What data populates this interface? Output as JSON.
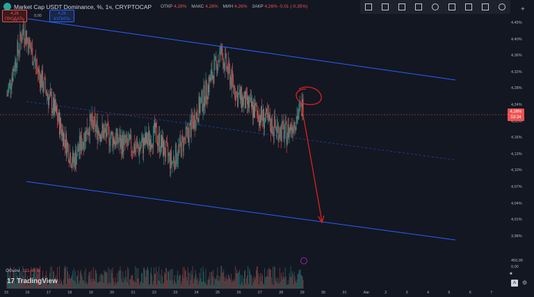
{
  "header": {
    "title": "Market Cap USDT Dominance, %, 1ч, CRYPTOCAP",
    "ohlc": [
      {
        "label": "ОТКР",
        "value": "4,28%"
      },
      {
        "label": "МАКС",
        "value": "4,28%"
      },
      {
        "label": "МИН",
        "value": "4,26%"
      },
      {
        "label": "ЗАКР",
        "value": "4,26%  -0,01 (-0,35%)"
      }
    ]
  },
  "trade": {
    "sell_price": "4,26",
    "sell_label": "ПРОДАТЬ",
    "spread": "0,00",
    "buy_price": "4,26",
    "buy_label": "КУПИТЬ"
  },
  "toolbar": {
    "icons": [
      "rectangle-tool-icon",
      "parallel-channel-icon",
      "fib-icon",
      "pitchfork-icon",
      "pattern-icon",
      "long-position-icon",
      "short-position-icon",
      "arrow-tool-icon",
      "eraser-icon"
    ]
  },
  "price_axis": {
    "labels": [
      "4,45%",
      "4,40%",
      "4,36%",
      "4,32%",
      "4,28%",
      "4,24%",
      "4,20%",
      "4,16%",
      "4,13%",
      "4,10%",
      "4,07%",
      "4,04%",
      "4,01%",
      "3,98%"
    ],
    "current_price": "4,26%",
    "countdown": "53:34",
    "volume_axis": "450,00",
    "volume_axis2": "0,00"
  },
  "time_axis": {
    "labels": [
      "15",
      "16",
      "17",
      "18",
      "19",
      "20",
      "21",
      "22",
      "23",
      "24",
      "25",
      "26",
      "27",
      "28",
      "29",
      "30",
      "31",
      "Авг",
      "2",
      "3",
      "4",
      "5",
      "6",
      "7"
    ]
  },
  "volume": {
    "label": "Объём",
    "value": "111,48 В"
  },
  "brand": {
    "name": "TradingView"
  },
  "colors": {
    "background": "#131722",
    "channel_line": "#2962ff",
    "annotation": "#e0201d",
    "down": "#ef5350",
    "up": "#26a69a"
  },
  "chart_data": {
    "type": "candlestick",
    "x_labels": [
      "15",
      "16",
      "17",
      "18",
      "19",
      "20",
      "21",
      "22",
      "23",
      "24",
      "25",
      "26",
      "27",
      "28",
      "29",
      "30",
      "31",
      "Авг",
      "2",
      "3",
      "4",
      "5",
      "6",
      "7"
    ],
    "ylim": [
      3.96,
      4.47
    ],
    "series": [
      {
        "values": [
          4.3,
          4.44,
          4.34,
          4.26,
          4.16,
          4.24,
          4.22,
          4.2,
          4.19,
          4.22,
          4.16,
          4.22,
          4.3,
          4.39,
          4.3,
          4.27,
          4.24,
          4.22,
          4.28
        ]
      }
    ],
    "current_price": 4.26
  }
}
